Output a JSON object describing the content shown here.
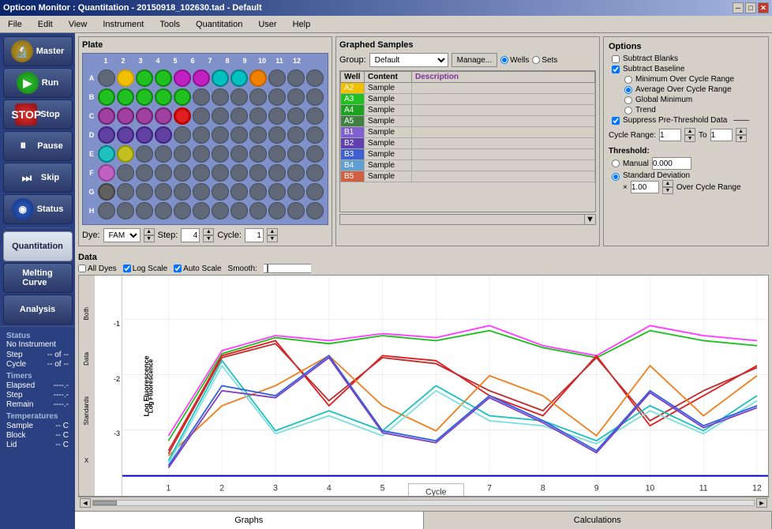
{
  "titlebar": {
    "title": "Opticon Monitor : Quantitation - 20150918_102630.tad - Default",
    "minimize": "─",
    "maximize": "□",
    "close": "✕"
  },
  "menu": {
    "items": [
      "File",
      "Edit",
      "View",
      "Instrument",
      "Tools",
      "Quantitation",
      "User",
      "Help"
    ]
  },
  "sidebar": {
    "master_label": "Master",
    "run_label": "Run",
    "stop_label": "Stop",
    "pause_label": "Pause",
    "skip_label": "Skip",
    "status_label": "Status",
    "quantitation_label": "Quantitation",
    "melting_curve_label": "Melting\nCurve",
    "analysis_label": "Analysis"
  },
  "status_panel": {
    "title": "Status",
    "instrument": "No Instrument",
    "step_label": "Step",
    "step_value": "-- of --",
    "cycle_label": "Cycle",
    "cycle_value": "-- of --",
    "timers_label": "Timers",
    "elapsed_label": "Elapsed",
    "elapsed_value": "----.-",
    "step_time_label": "Step",
    "step_time_value": "----.-",
    "remain_label": "Remain",
    "remain_value": "----.-",
    "temps_label": "Temperatures",
    "sample_label": "Sample",
    "sample_value": "-- C",
    "block_label": "Block",
    "block_value": "-- C",
    "lid_label": "Lid",
    "lid_value": "-- C"
  },
  "plate": {
    "title": "Plate",
    "rows": [
      "A",
      "B",
      "C",
      "D",
      "E",
      "F",
      "G",
      "H"
    ],
    "cols": [
      "1",
      "2",
      "3",
      "4",
      "5",
      "6",
      "7",
      "8",
      "9",
      "10",
      "11",
      "12"
    ]
  },
  "plate_controls": {
    "dye_label": "Dye:",
    "dye_value": "FAM",
    "step_label": "Step:",
    "step_value": "4",
    "cycle_label": "Cycle:",
    "cycle_value": "1"
  },
  "graphed_samples": {
    "title": "Graphed Samples",
    "group_label": "Group:",
    "group_value": "Default",
    "manage_label": "Manage...",
    "wells_label": "Wells",
    "sets_label": "Sets",
    "table_headers": [
      "Well",
      "Content",
      "Description"
    ],
    "rows": [
      {
        "well": "A2",
        "content": "Sample",
        "desc": "",
        "color": "#f0c000"
      },
      {
        "well": "A3",
        "content": "Sample",
        "desc": "",
        "color": "#20c020"
      },
      {
        "well": "A4",
        "content": "Sample",
        "desc": "",
        "color": "#20a020"
      },
      {
        "well": "A5",
        "content": "Sample",
        "desc": "",
        "color": "#408040"
      },
      {
        "well": "B1",
        "content": "Sample",
        "desc": "",
        "color": "#8060d0"
      },
      {
        "well": "B2",
        "content": "Sample",
        "desc": "",
        "color": "#6040b0"
      },
      {
        "well": "B3",
        "content": "Sample",
        "desc": "",
        "color": "#4060d0"
      },
      {
        "well": "B4",
        "content": "Sample",
        "desc": "",
        "color": "#60a0d0"
      },
      {
        "well": "B5",
        "content": "Sample",
        "desc": "",
        "color": "#d06040"
      }
    ]
  },
  "options": {
    "title": "Options",
    "subtract_blanks_label": "Subtract Blanks",
    "subtract_baseline_label": "Subtract Baseline",
    "min_over_cycle_label": "Minimum Over Cycle Range",
    "avg_over_cycle_label": "Average Over Cycle Range",
    "global_min_label": "Global Minimum",
    "trend_label": "Trend",
    "suppress_label": "Suppress Pre-Threshold Data",
    "cycle_range_label": "Cycle Range:",
    "to_label": "To",
    "cycle_from": "1",
    "cycle_to": "1",
    "threshold_title": "Threshold:",
    "manual_label": "Manual",
    "manual_value": "0.000",
    "std_dev_label": "Standard Deviation",
    "over_cycle_label": "Over Cycle Range",
    "multiplier": "×",
    "std_dev_value": "1.00"
  },
  "data": {
    "title": "Data",
    "all_dyes_label": "All Dyes",
    "log_scale_label": "Log Scale",
    "auto_scale_label": "Auto Scale",
    "smooth_label": "Smooth:",
    "y_axis_label": "Log Fluorescence",
    "x_axis_label": "Cycle",
    "y_ticks": [
      "-1",
      "-2",
      "-3"
    ],
    "x_ticks": [
      "1",
      "2",
      "3",
      "4",
      "5",
      "6",
      "7",
      "8",
      "9",
      "10",
      "11",
      "12"
    ],
    "both_label": "Both",
    "data_label": "Data",
    "standards_label": "Standards",
    "x_label": "X"
  },
  "bottom_tabs": {
    "graphs_label": "Graphs",
    "calculations_label": "Calculations"
  }
}
